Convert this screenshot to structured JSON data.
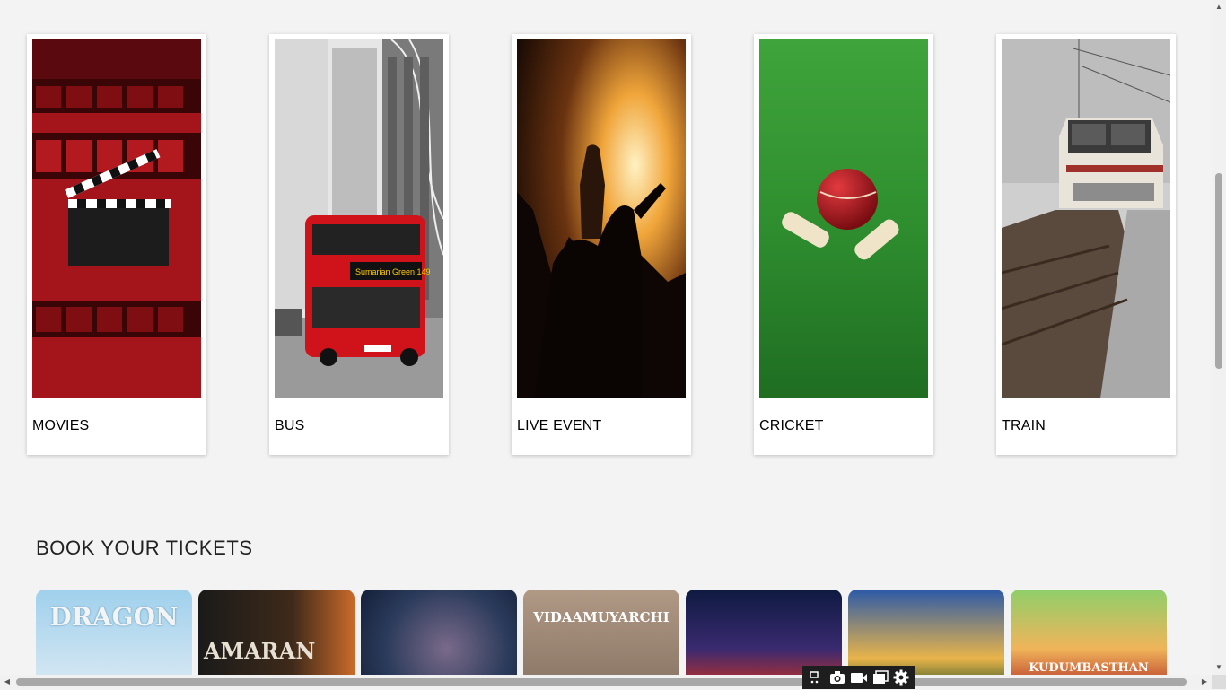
{
  "categories": [
    {
      "label": "MOVIES"
    },
    {
      "label": "BUS"
    },
    {
      "label": "LIVE EVENT"
    },
    {
      "label": "CRICKET"
    },
    {
      "label": "TRAIN"
    }
  ],
  "section": {
    "title": "BOOK YOUR TICKETS"
  },
  "posters": [
    {
      "text": "DRAGON"
    },
    {
      "text": "AMARAN"
    },
    {
      "text": ""
    },
    {
      "text": "VIDAAMUYARCHI"
    },
    {
      "text": ""
    },
    {
      "text": ""
    },
    {
      "text": "KUDUMBASTHAN"
    }
  ],
  "toolbar": {
    "icons": [
      "snip-icon",
      "camera-icon",
      "video-icon",
      "window-icon",
      "gear-icon"
    ]
  }
}
